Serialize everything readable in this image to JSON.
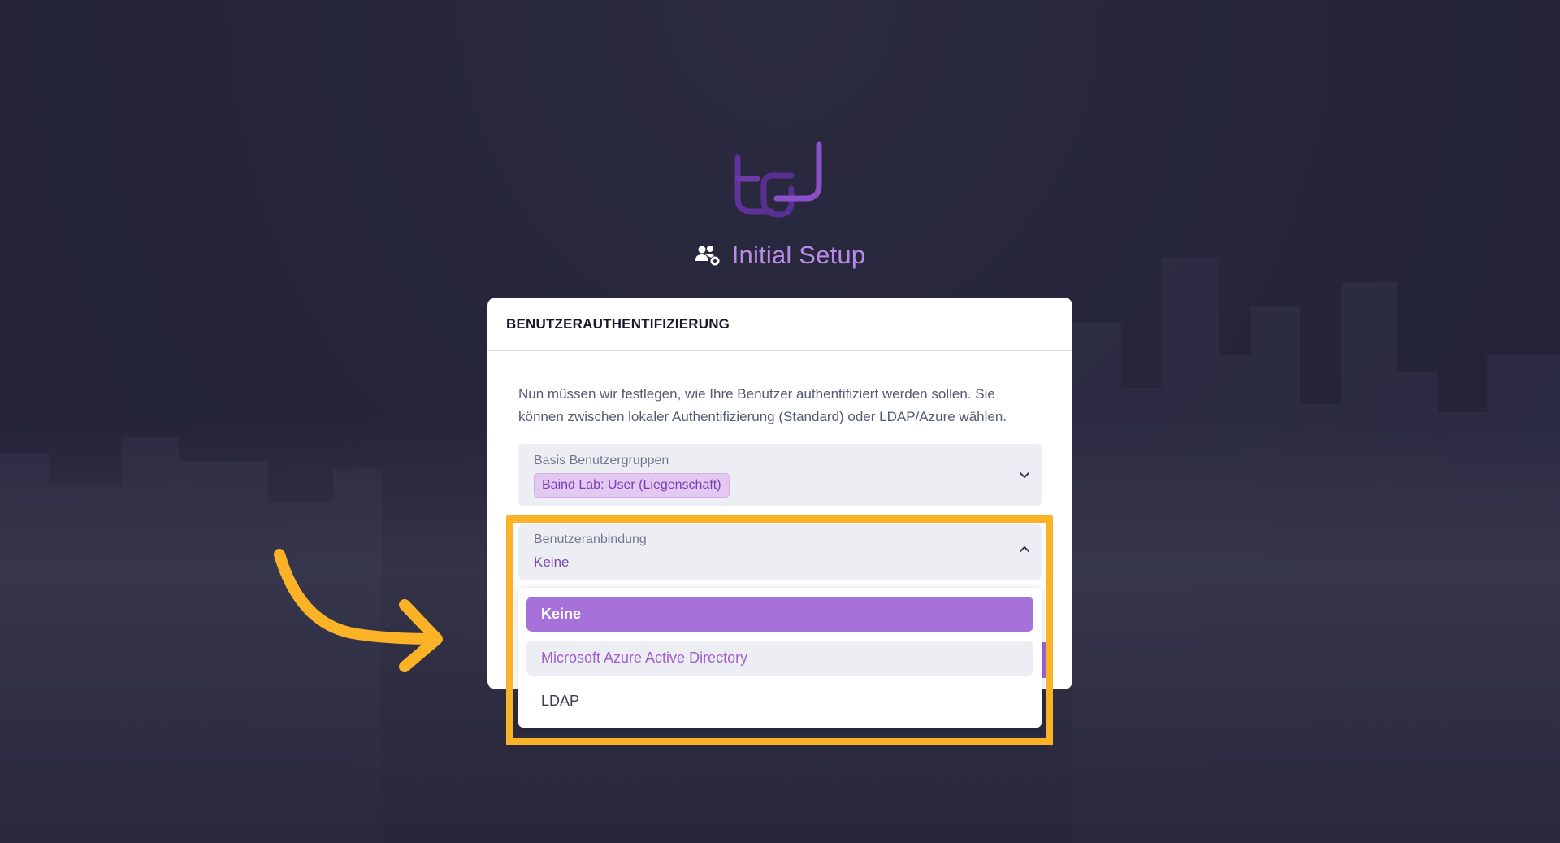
{
  "app": {
    "title": "Initial Setup"
  },
  "card": {
    "header": "BENUTZERAUTHENTIFIZIERUNG",
    "description": "Nun müssen wir festlegen, wie Ihre Benutzer authentifiziert werden sollen. Sie können zwischen lokaler Authentifizierung (Standard) oder LDAP/Azure wählen."
  },
  "groups_field": {
    "label": "Basis Benutzergruppen",
    "selected_chip": "Baind Lab: User (Liegenschaft)"
  },
  "binding_field": {
    "label": "Benutzeranbindung",
    "value": "Keine",
    "expanded": true,
    "options": [
      {
        "label": "Keine",
        "state": "selected"
      },
      {
        "label": "Microsoft Azure Active Directory",
        "state": "hover"
      },
      {
        "label": "LDAP",
        "state": "default"
      }
    ]
  },
  "icons": {
    "logo": "brand-logo-icon",
    "title": "users-gear-icon",
    "groups_toggle": "chevron-down-icon",
    "binding_toggle": "chevron-up-icon",
    "annotation": "curved-arrow-icon"
  },
  "colors": {
    "background": "#23233a",
    "accent": "#a672d9",
    "title": "#b98ae6",
    "chip_bg": "#e3c8f2",
    "highlight": "#fbb226"
  }
}
